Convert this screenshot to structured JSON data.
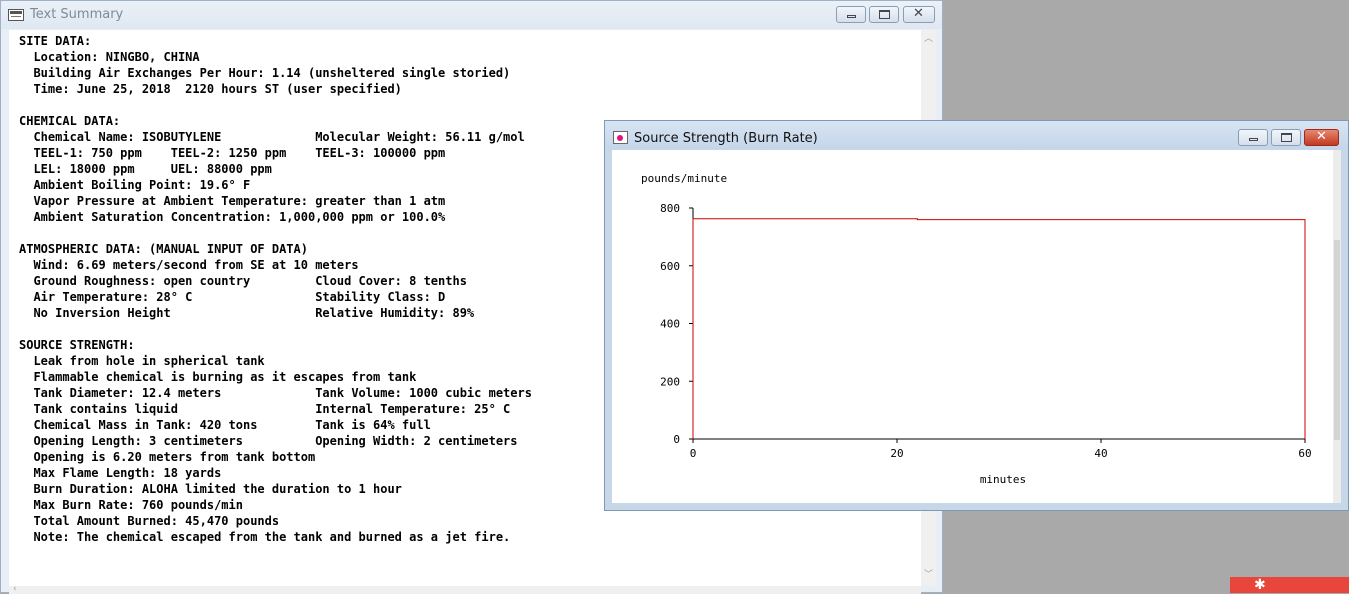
{
  "text_summary_window": {
    "title": "Text Summary",
    "icon": "text-document-icon",
    "lines": [
      "SITE DATA:",
      "  Location: NINGBO, CHINA",
      "  Building Air Exchanges Per Hour: 1.14 (unsheltered single storied)",
      "  Time: June 25, 2018  2120 hours ST (user specified)",
      "",
      "CHEMICAL DATA:",
      "  Chemical Name: ISOBUTYLENE             Molecular Weight: 56.11 g/mol",
      "  TEEL-1: 750 ppm    TEEL-2: 1250 ppm    TEEL-3: 100000 ppm",
      "  LEL: 18000 ppm     UEL: 88000 ppm",
      "  Ambient Boiling Point: 19.6° F",
      "  Vapor Pressure at Ambient Temperature: greater than 1 atm",
      "  Ambient Saturation Concentration: 1,000,000 ppm or 100.0%",
      "",
      "ATMOSPHERIC DATA: (MANUAL INPUT OF DATA)",
      "  Wind: 6.69 meters/second from SE at 10 meters",
      "  Ground Roughness: open country         Cloud Cover: 8 tenths",
      "  Air Temperature: 28° C                 Stability Class: D",
      "  No Inversion Height                    Relative Humidity: 89%",
      "",
      "SOURCE STRENGTH:",
      "  Leak from hole in spherical tank",
      "  Flammable chemical is burning as it escapes from tank",
      "  Tank Diameter: 12.4 meters             Tank Volume: 1000 cubic meters",
      "  Tank contains liquid                   Internal Temperature: 25° C",
      "  Chemical Mass in Tank: 420 tons        Tank is 64% full",
      "  Opening Length: 3 centimeters          Opening Width: 2 centimeters",
      "  Opening is 6.20 meters from tank bottom",
      "  Max Flame Length: 18 yards",
      "  Burn Duration: ALOHA limited the duration to 1 hour",
      "  Max Burn Rate: 760 pounds/min",
      "  Total Amount Burned: 45,470 pounds",
      "  Note: The chemical escaped from the tank and burned as a jet fire."
    ]
  },
  "source_strength_window": {
    "title": "Source Strength (Burn Rate)",
    "icon": "graph-window-icon"
  },
  "chart_data": {
    "type": "line",
    "title": "",
    "ylabel": "pounds/minute",
    "xlabel": "minutes",
    "xlim": [
      0,
      60
    ],
    "ylim": [
      0,
      800
    ],
    "xticks": [
      0,
      20,
      40,
      60
    ],
    "yticks": [
      0,
      200,
      400,
      600,
      800
    ],
    "grid": false,
    "line_color": "#cc0000",
    "series": [
      {
        "x": [
          0,
          0,
          22,
          22,
          60,
          60
        ],
        "y": [
          0,
          763,
          763,
          760,
          760,
          0
        ]
      }
    ]
  },
  "colors": {
    "desktop": "#a9a9a9",
    "corner_badge": "#e8463a"
  }
}
